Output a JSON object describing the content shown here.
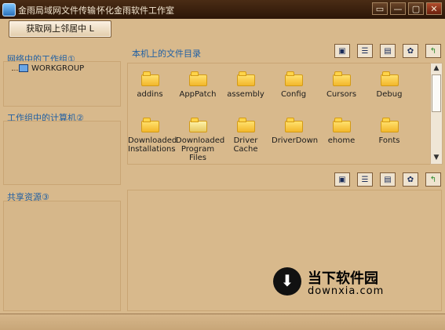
{
  "window": {
    "title": "金雨局域网文件传输",
    "vendor": "怀化金雨软件工作室",
    "controls": [
      "▭",
      "—",
      "▢",
      "✕"
    ]
  },
  "left": {
    "get_button": "获取网上邻居中 L",
    "workgroups_title": "网络中的工作组①",
    "workgroup_item": "WORKGROUP",
    "computers_title": "工作组中的计算机②",
    "shares_title": "共享资源③"
  },
  "right": {
    "dir_title": "本机上的文件目录",
    "toolbar_icons": [
      "large-icons-icon",
      "list-view-icon",
      "details-view-icon",
      "color-icon",
      "up-folder-icon"
    ],
    "files": [
      {
        "name": "addins",
        "icon": "folder-icon"
      },
      {
        "name": "AppPatch",
        "icon": "folder-icon"
      },
      {
        "name": "assembly",
        "icon": "folder-icon"
      },
      {
        "name": "Config",
        "icon": "folder-icon"
      },
      {
        "name": "Cursors",
        "icon": "folder-icon"
      },
      {
        "name": "Debug",
        "icon": "folder-icon"
      },
      {
        "name": "Downloaded Installations",
        "icon": "folder-icon"
      },
      {
        "name": "Downloaded Program Files",
        "icon": "folder-open-icon"
      },
      {
        "name": "Driver Cache",
        "icon": "folder-icon"
      },
      {
        "name": "DriverDown",
        "icon": "folder-icon"
      },
      {
        "name": "ehome",
        "icon": "folder-icon"
      },
      {
        "name": "Fonts",
        "icon": "folder-icon"
      }
    ]
  },
  "watermark": {
    "chinese": "当下软件园",
    "url": "downxia.com"
  }
}
